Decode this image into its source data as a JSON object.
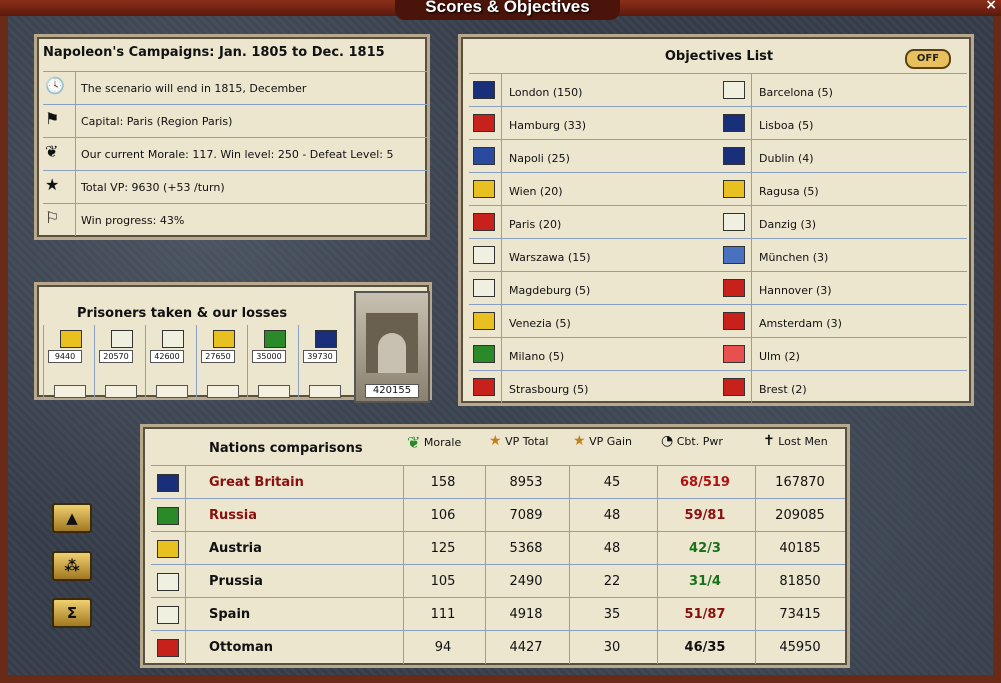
{
  "window": {
    "title": "Scores & Objectives",
    "close_label": "×"
  },
  "scenario": {
    "title": "Napoleon's Campaigns: Jan. 1805 to Dec. 1815",
    "rows": [
      {
        "icon": "clock-icon",
        "text": "The scenario will end in 1815, December"
      },
      {
        "icon": "capital-flag-icon",
        "text": "Capital: Paris (Region Paris)"
      },
      {
        "icon": "laurel-icon",
        "text": "Our current Morale: 117. Win level: 250 - Defeat Level: 5"
      },
      {
        "icon": "medal-icon",
        "text": "Total VP: 9630 (+53 /turn)"
      },
      {
        "icon": "flags-icon",
        "text": "Win progress: 43%"
      }
    ]
  },
  "objectives": {
    "title": "Objectives List",
    "toggle_label": "OFF",
    "left": [
      {
        "label": "London (150)",
        "flag": "#1a2f7a"
      },
      {
        "label": "Hamburg (33)",
        "flag": "#c8201a"
      },
      {
        "label": "Napoli (25)",
        "flag": "#2a4aa0"
      },
      {
        "label": "Wien (20)",
        "flag": "#e8c020"
      },
      {
        "label": "Paris (20)",
        "flag": "#c8201a"
      },
      {
        "label": "Warszawa (15)",
        "flag": "#f0f0e0"
      },
      {
        "label": "Magdeburg (5)",
        "flag": "#f0f0e0"
      },
      {
        "label": "Venezia (5)",
        "flag": "#e8c020"
      },
      {
        "label": "Milano (5)",
        "flag": "#2a8a2a"
      },
      {
        "label": "Strasbourg (5)",
        "flag": "#c8201a"
      }
    ],
    "right": [
      {
        "label": "Barcelona (5)",
        "flag": "#f0f0e0"
      },
      {
        "label": "Lisboa (5)",
        "flag": "#1a2f7a"
      },
      {
        "label": "Dublin (4)",
        "flag": "#1a2f7a"
      },
      {
        "label": "Ragusa (5)",
        "flag": "#e8c020"
      },
      {
        "label": "Danzig (3)",
        "flag": "#f0f0e0"
      },
      {
        "label": "München (3)",
        "flag": "#4a70c0"
      },
      {
        "label": "Hannover (3)",
        "flag": "#c8201a"
      },
      {
        "label": "Amsterdam (3)",
        "flag": "#c8201a"
      },
      {
        "label": "Ulm (2)",
        "flag": "#e85050"
      },
      {
        "label": "Brest (2)",
        "flag": "#c8201a"
      }
    ]
  },
  "prisoners": {
    "title": "Prisoners taken & our losses",
    "columns": [
      {
        "value": "9440",
        "flag": "#e8c020"
      },
      {
        "value": "20570",
        "flag": "#f0f0e0"
      },
      {
        "value": "42600",
        "flag": "#f0f0e0"
      },
      {
        "value": "27650",
        "flag": "#e8c020"
      },
      {
        "value": "35000",
        "flag": "#2a8a2a"
      },
      {
        "value": "39730",
        "flag": "#1a2f7a"
      }
    ],
    "total": "420155"
  },
  "nations": {
    "title": "Nations comparisons",
    "headers": {
      "morale": "Morale",
      "vp_total": "VP Total",
      "vp_gain": "VP Gain",
      "cbt_pwr": "Cbt. Pwr",
      "lost_men": "Lost Men"
    },
    "rows": [
      {
        "name": "Great Britain",
        "flag": "#1a2f7a",
        "morale": "158",
        "vp_total": "8953",
        "vp_gain": "45",
        "cbt": "68/519",
        "cbt_color": "#b01010",
        "lost": "167870",
        "name_color": "#8a1010"
      },
      {
        "name": "Russia",
        "flag": "#2a8a2a",
        "morale": "106",
        "vp_total": "7089",
        "vp_gain": "48",
        "cbt": "59/81",
        "cbt_color": "#8a1010",
        "lost": "209085",
        "name_color": "#8a1010"
      },
      {
        "name": "Austria",
        "flag": "#e8c020",
        "morale": "125",
        "vp_total": "5368",
        "vp_gain": "48",
        "cbt": "42/3",
        "cbt_color": "#187018",
        "lost": "40185",
        "name_color": "#111111"
      },
      {
        "name": "Prussia",
        "flag": "#f0f0e0",
        "morale": "105",
        "vp_total": "2490",
        "vp_gain": "22",
        "cbt": "31/4",
        "cbt_color": "#187018",
        "lost": "81850",
        "name_color": "#111111"
      },
      {
        "name": "Spain",
        "flag": "#f0f0e0",
        "morale": "111",
        "vp_total": "4918",
        "vp_gain": "35",
        "cbt": "51/87",
        "cbt_color": "#8a1010",
        "lost": "73415",
        "name_color": "#111111"
      },
      {
        "name": "Ottoman",
        "flag": "#c8201a",
        "morale": "94",
        "vp_total": "4427",
        "vp_gain": "30",
        "cbt": "46/35",
        "cbt_color": "#111111",
        "lost": "45950",
        "name_color": "#111111"
      }
    ]
  },
  "side_buttons": [
    {
      "icon": "tent-icon",
      "glyph": "▲"
    },
    {
      "icon": "units-icon",
      "glyph": "⁂"
    },
    {
      "icon": "sum-icon",
      "glyph": "Σ"
    }
  ]
}
